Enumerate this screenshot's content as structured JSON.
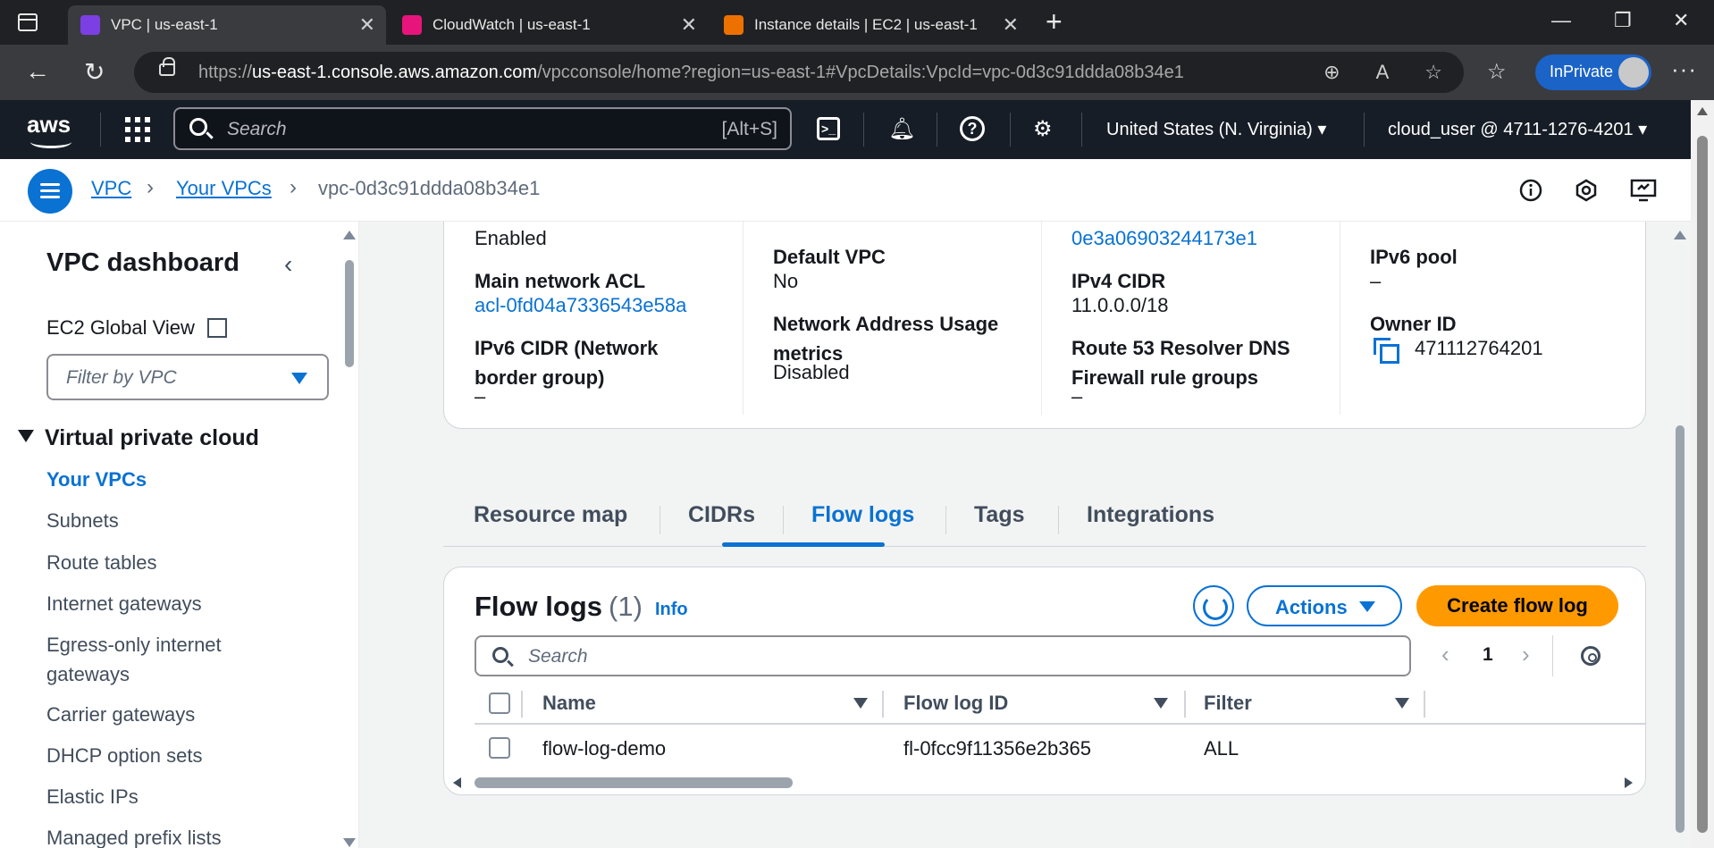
{
  "browser": {
    "tabs": [
      {
        "label": "VPC | us-east-1",
        "color": "#7b3fe4"
      },
      {
        "label": "CloudWatch | us-east-1",
        "color": "#e7157b"
      },
      {
        "label": "Instance details | EC2 | us-east-1",
        "color": "#ed7100"
      }
    ],
    "url_prefix": "https://",
    "url_host": "us-east-1.console.aws.amazon.com",
    "url_path": "/vpcconsole/home?region=us-east-1#VpcDetails:VpcId=vpc-0d3c91ddda08b34e1",
    "inprivate_label": "InPrivate"
  },
  "aws_nav": {
    "search_placeholder": "Search",
    "search_shortcut": "[Alt+S]",
    "region": "United States (N. Virginia)",
    "account": "cloud_user @ 4711-1276-4201"
  },
  "breadcrumb": {
    "items": [
      "VPC",
      "Your VPCs"
    ],
    "current": "vpc-0d3c91ddda08b34e1"
  },
  "sidebar": {
    "title": "VPC dashboard",
    "ec2_global_view": "EC2 Global View",
    "filter_placeholder": "Filter by VPC",
    "section": "Virtual private cloud",
    "items": [
      {
        "label": "Your VPCs",
        "active": true
      },
      {
        "label": "Subnets"
      },
      {
        "label": "Route tables"
      },
      {
        "label": "Internet gateways"
      },
      {
        "label": "Egress-only internet gateways"
      },
      {
        "label": "Carrier gateways"
      },
      {
        "label": "DHCP option sets"
      },
      {
        "label": "Elastic IPs"
      },
      {
        "label": "Managed prefix lists"
      }
    ]
  },
  "details": {
    "col1": {
      "top_value": "Enabled",
      "main_acl_label": "Main network ACL",
      "main_acl_value": "acl-0fd04a7336543e58a",
      "ipv6_cidr_label": "IPv6 CIDR (Network border group)",
      "ipv6_cidr_value": "–"
    },
    "col2": {
      "default_vpc_label": "Default VPC",
      "default_vpc_value": "No",
      "nau_label": "Network Address Usage metrics",
      "nau_value": "Disabled"
    },
    "col3": {
      "top_value": "0e3a06903244173e1",
      "ipv4_cidr_label": "IPv4 CIDR",
      "ipv4_cidr_value": "11.0.0.0/18",
      "route53_label": "Route 53 Resolver DNS Firewall rule groups",
      "route53_value": "–"
    },
    "col4": {
      "ipv6_pool_label": "IPv6 pool",
      "ipv6_pool_value": "–",
      "owner_label": "Owner ID",
      "owner_value": "471112764201"
    }
  },
  "tabs": [
    "Resource map",
    "CIDRs",
    "Flow logs",
    "Tags",
    "Integrations"
  ],
  "flow_logs": {
    "title": "Flow logs",
    "count": "(1)",
    "info": "Info",
    "actions_label": "Actions",
    "create_label": "Create flow log",
    "search_placeholder": "Search",
    "page": "1",
    "columns": [
      "Name",
      "Flow log ID",
      "Filter"
    ],
    "rows": [
      {
        "name": "flow-log-demo",
        "id": "fl-0fcc9f11356e2b365",
        "filter": "ALL"
      }
    ]
  }
}
